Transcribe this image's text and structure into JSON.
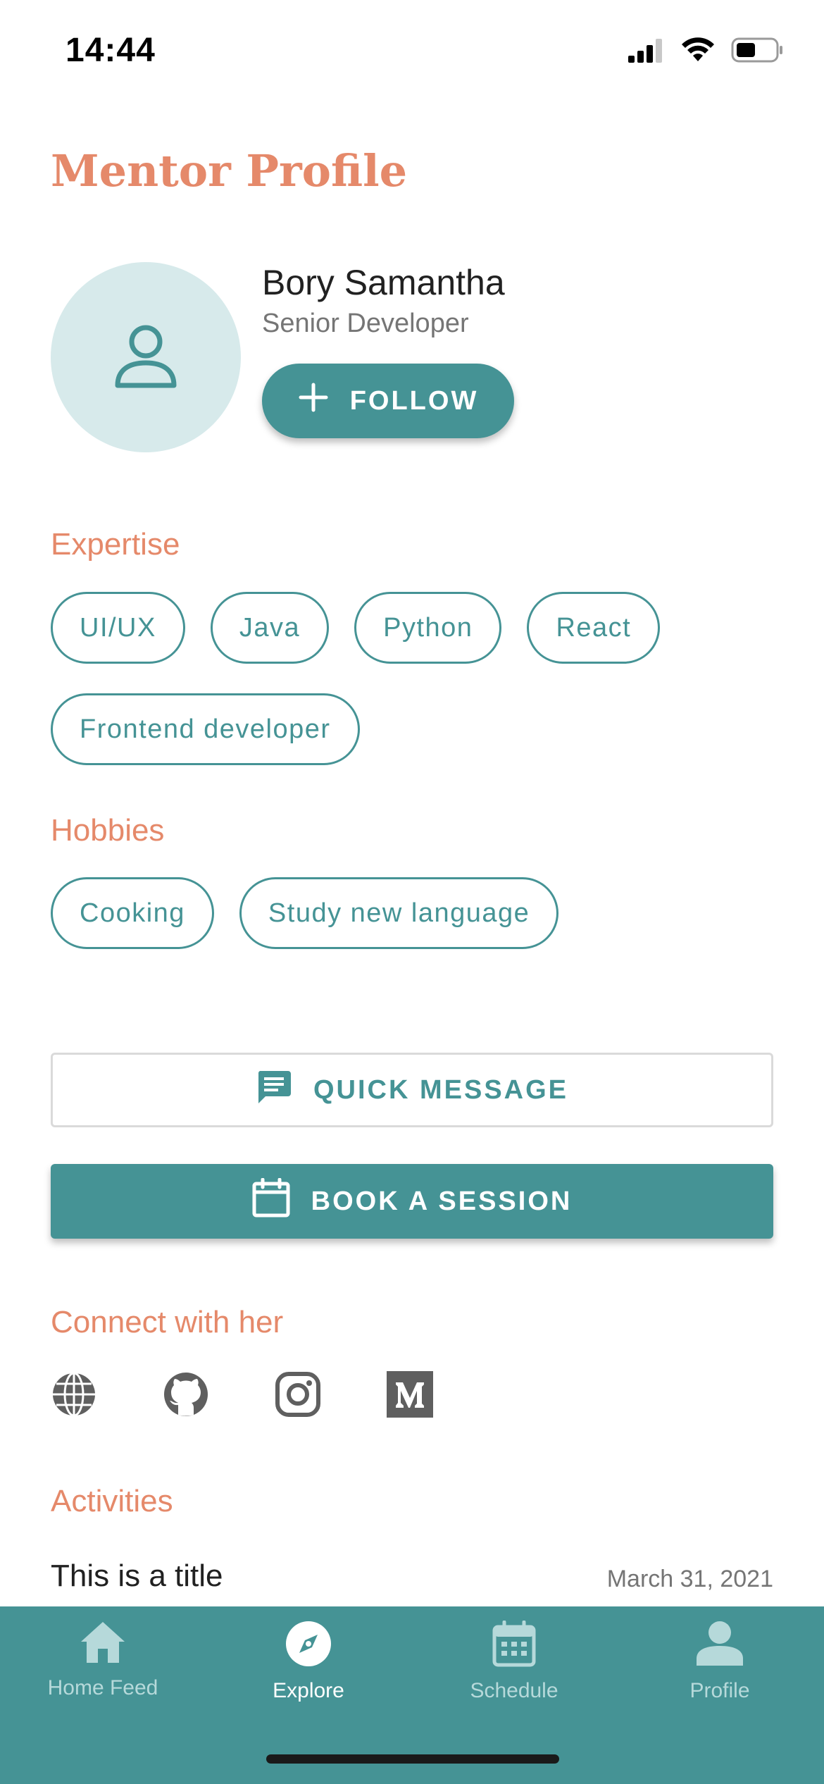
{
  "status_bar": {
    "time": "14:44",
    "icons": [
      "cellular-signal-icon",
      "wifi-icon",
      "battery-icon"
    ]
  },
  "header": {
    "title": "Mentor Profile"
  },
  "mentor": {
    "name": "Bory Samantha",
    "role": "Senior Developer",
    "avatar_icon": "user-outline-icon",
    "follow_label": "FOLLOW",
    "follow_icon": "plus-icon"
  },
  "expertise": {
    "label": "Expertise",
    "chips": [
      "UI/UX",
      "Java",
      "Python",
      "React",
      "Frontend developer"
    ]
  },
  "hobbies": {
    "label": "Hobbies",
    "chips": [
      "Cooking",
      "Study new language"
    ]
  },
  "actions": {
    "quick_message_label": "QUICK MESSAGE",
    "quick_message_icon": "chat-message-icon",
    "book_session_label": "BOOK A SESSION",
    "book_session_icon": "calendar-icon"
  },
  "connect": {
    "label": "Connect with her",
    "icons": [
      "globe-icon",
      "github-icon",
      "instagram-icon",
      "medium-icon"
    ]
  },
  "activities": {
    "label": "Activities",
    "items": [
      {
        "title": "This is a title",
        "date": "March 31, 2021"
      }
    ]
  },
  "tab_bar": {
    "tabs": [
      {
        "label": "Home Feed",
        "icon": "home-icon",
        "active": false
      },
      {
        "label": "Explore",
        "icon": "compass-icon",
        "active": true
      },
      {
        "label": "Schedule",
        "icon": "calendar-grid-icon",
        "active": false
      },
      {
        "label": "Profile",
        "icon": "person-icon",
        "active": false
      }
    ]
  },
  "colors": {
    "accent": "#459395",
    "heading": "#E5896A",
    "avatar_bg": "#D7EAEB",
    "tab_inactive": "#B6D9DA"
  }
}
